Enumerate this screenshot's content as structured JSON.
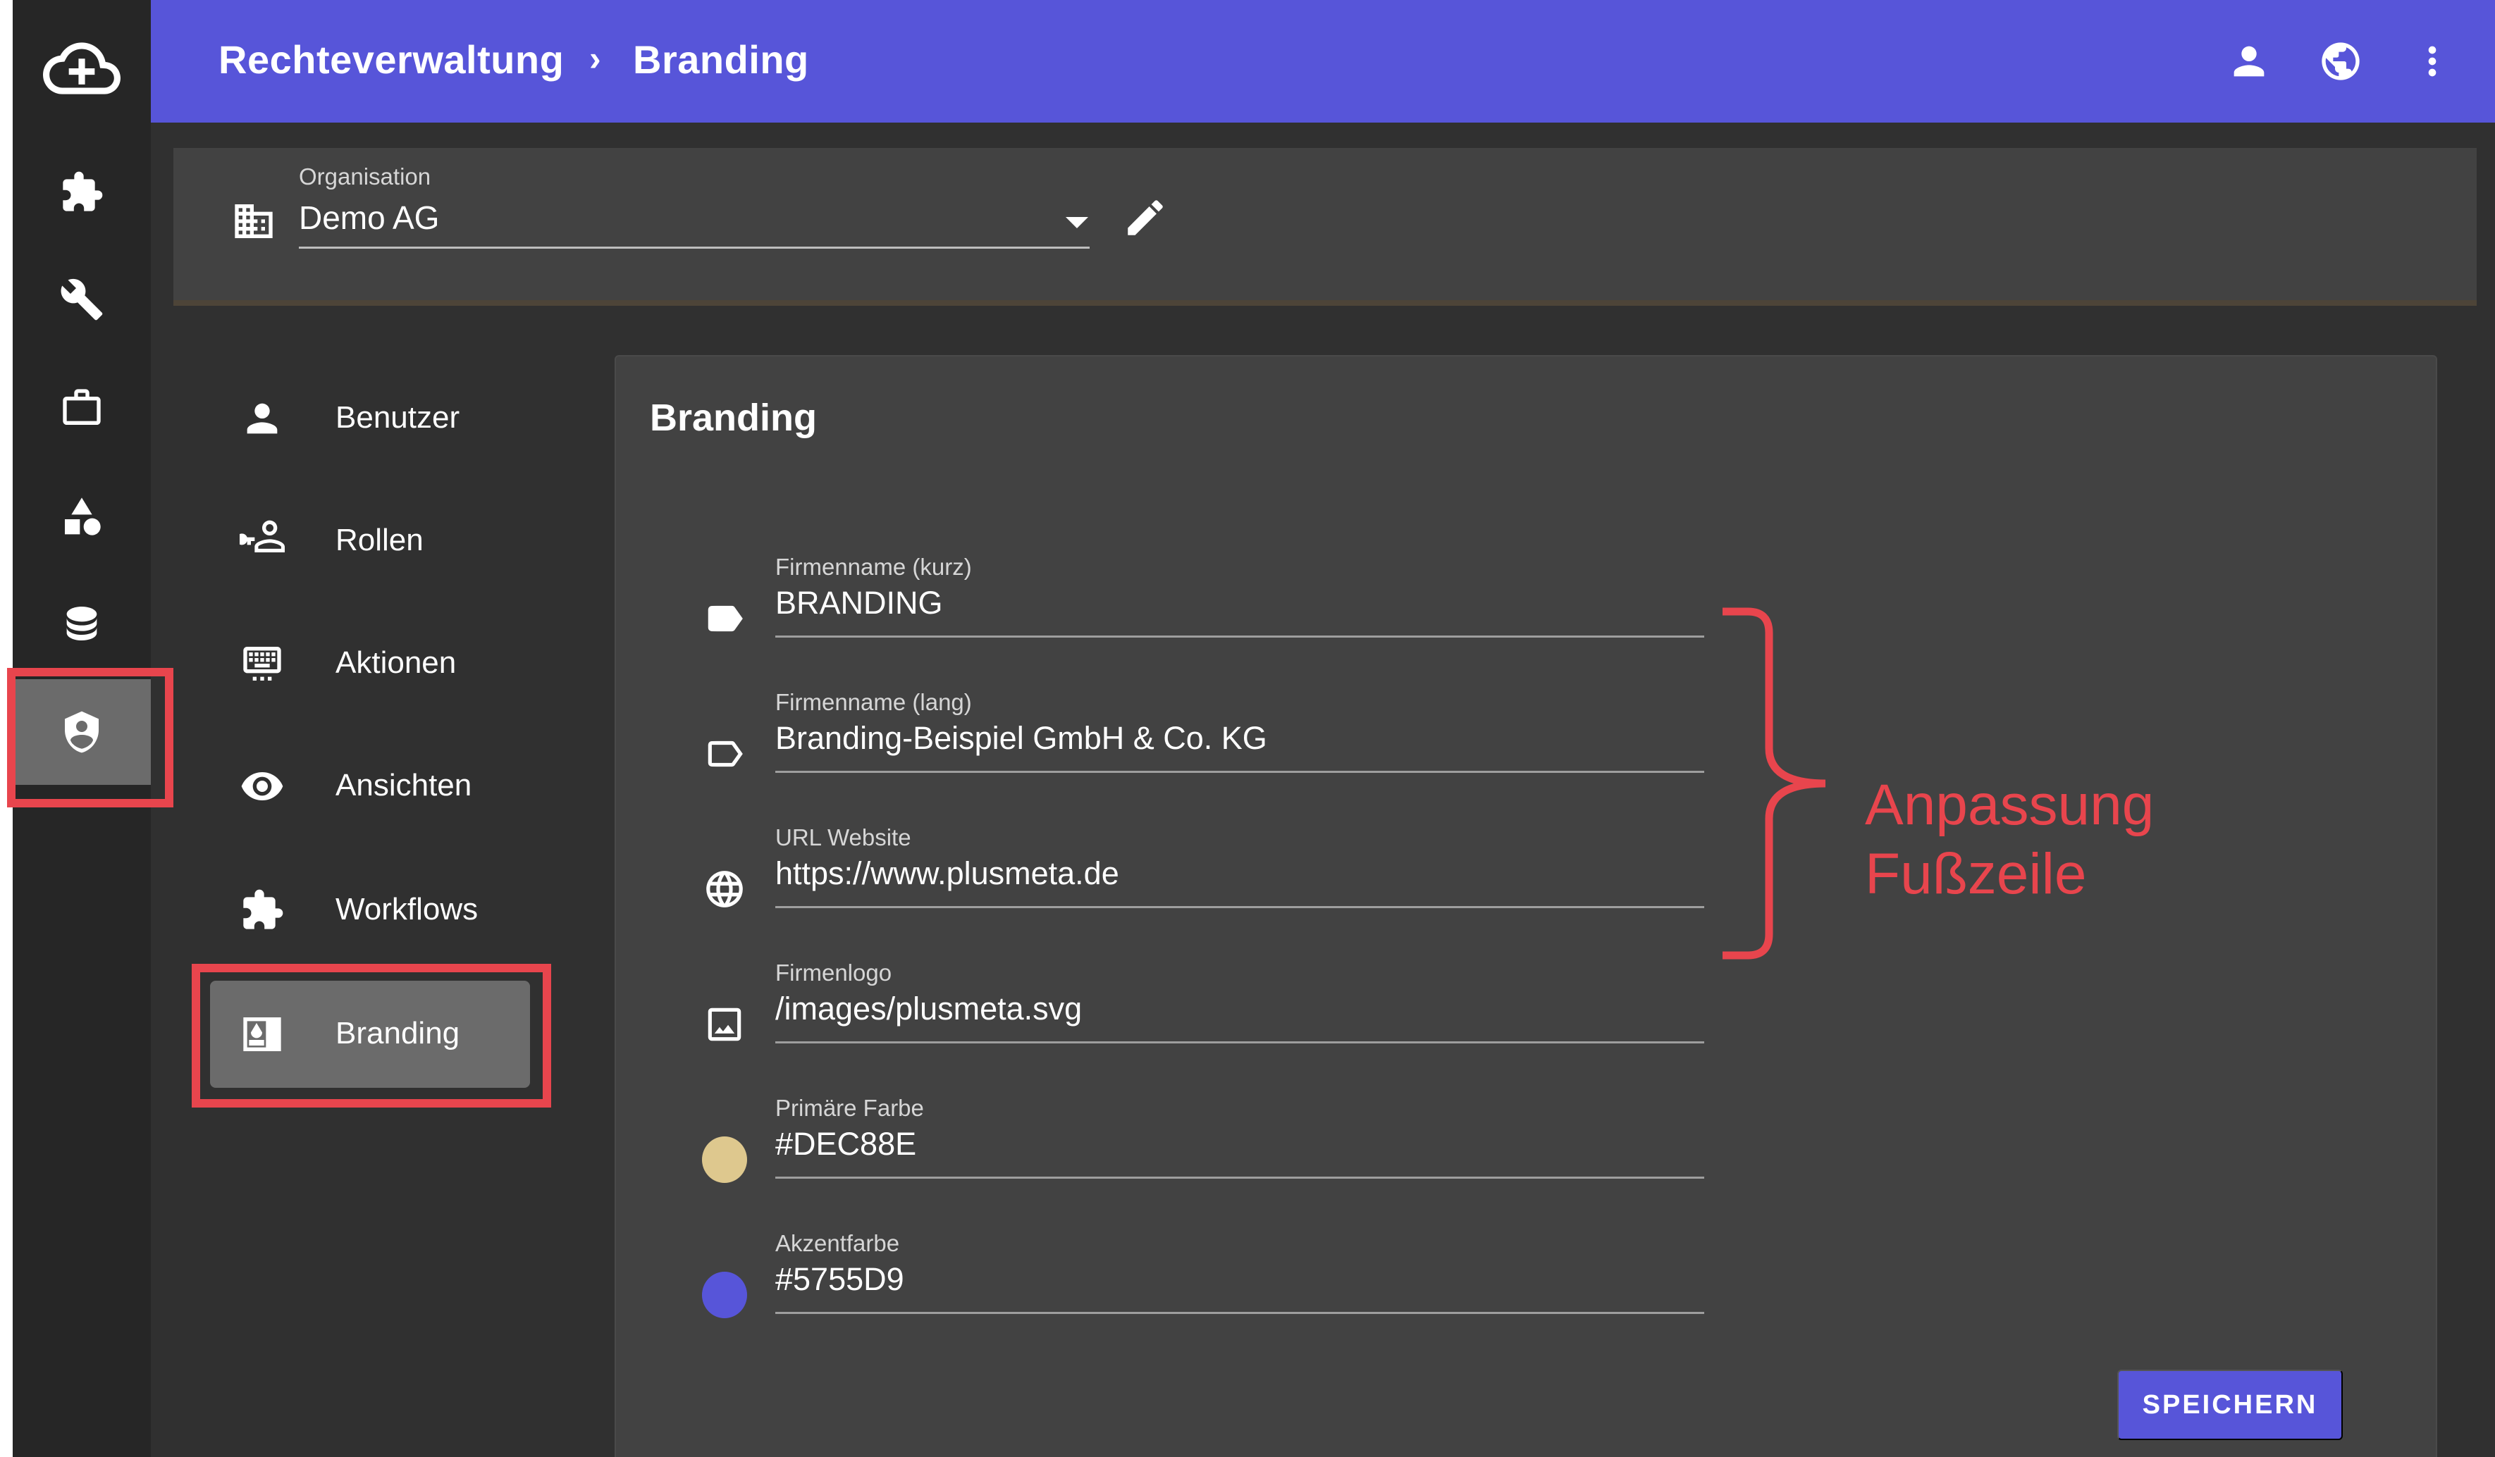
{
  "topbar": {
    "breadcrumb": [
      "Rechteverwaltung",
      "Branding"
    ],
    "separator": "›",
    "icons": [
      "account-icon",
      "globe-icon",
      "more-vert-icon"
    ]
  },
  "rail": {
    "items": [
      "cloud-upload-logo-icon",
      "puzzle-icon",
      "wrench-icon",
      "briefcase-icon",
      "shapes-icon",
      "database-icon",
      "shield-account-icon"
    ],
    "active": "shield-account-icon"
  },
  "organization": {
    "label": "Organisation",
    "value": "Demo AG"
  },
  "menu": {
    "items": [
      {
        "label": "Benutzer",
        "icon": "account-icon"
      },
      {
        "label": "Rollen",
        "icon": "account-key-icon"
      },
      {
        "label": "Aktionen",
        "icon": "keyboard-icon"
      },
      {
        "label": "Ansichten",
        "icon": "eye-icon"
      },
      {
        "label": "Workflows",
        "icon": "puzzle-icon"
      },
      {
        "label": "Branding",
        "icon": "card-account-icon"
      }
    ],
    "active": "Branding"
  },
  "card": {
    "title": "Branding",
    "fields": [
      {
        "label": "Firmenname (kurz)",
        "value": "BRANDING",
        "icon": "label-icon"
      },
      {
        "label": "Firmenname (lang)",
        "value": "Branding-Beispiel GmbH & Co. KG",
        "icon": "label-outline-icon"
      },
      {
        "label": "URL Website",
        "value": "https://www.plusmeta.de",
        "icon": "web-icon"
      },
      {
        "label": "Firmenlogo",
        "value": "/images/plusmeta.svg",
        "icon": "image-icon"
      },
      {
        "label": "Primäre Farbe",
        "value": "#DEC88E",
        "icon": "color-swatch"
      },
      {
        "label": "Akzentfarbe",
        "value": "#5755D9",
        "icon": "color-swatch"
      }
    ],
    "save_label": "SPEICHERN"
  },
  "annotation": {
    "lines": [
      "Anpassung",
      "Fußzeile"
    ],
    "color": "#e8454d"
  },
  "colors": {
    "primary": "#5755D9",
    "swatch_primary": "#DEC88E",
    "swatch_accent": "#5755D9"
  }
}
